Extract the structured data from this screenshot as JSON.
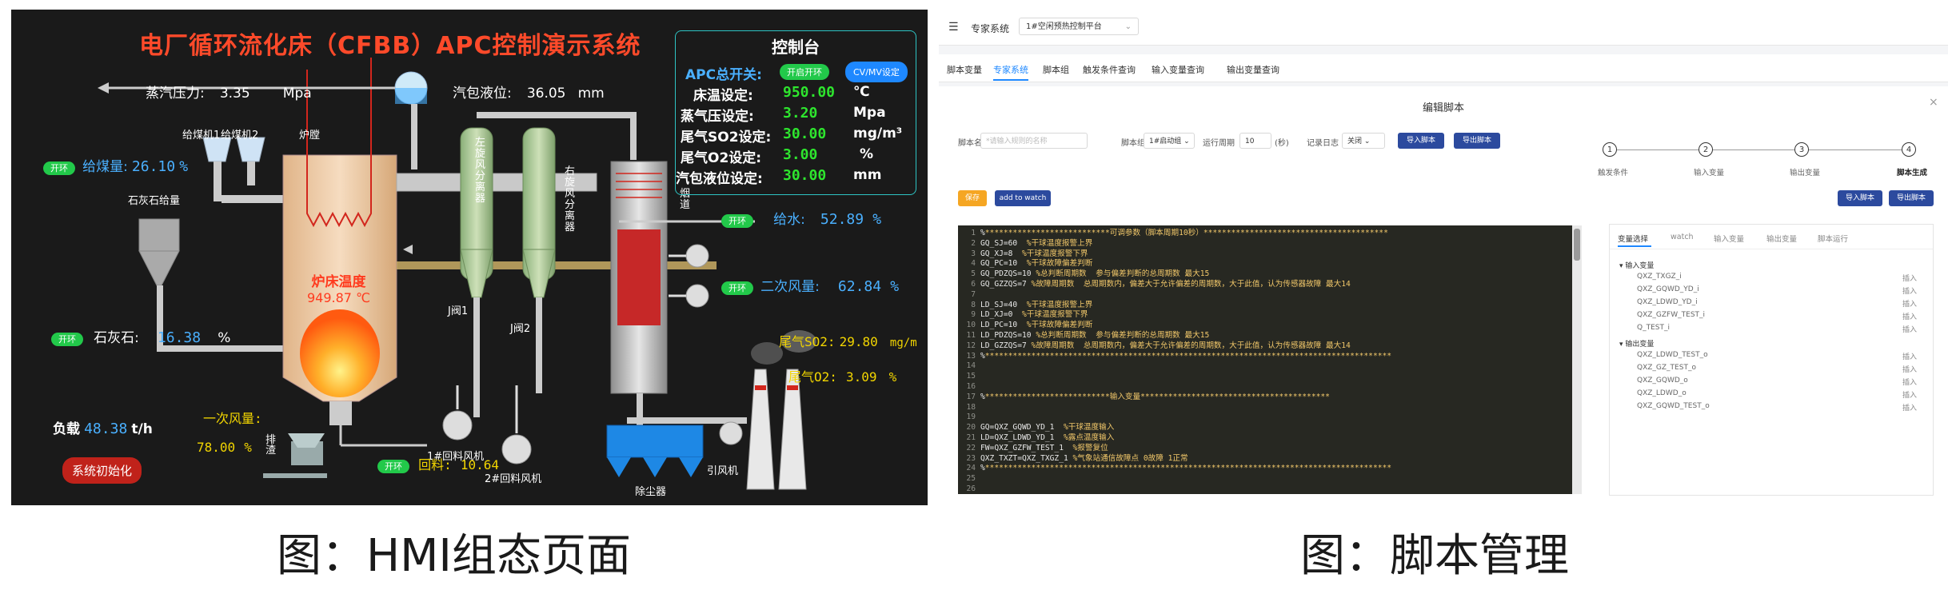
{
  "hmi": {
    "title": "电厂循环流化床（CFBB）APC控制演示系统",
    "steam_pressure": {
      "label": "蒸汽压力:",
      "value": "3.35",
      "unit": "Mpa"
    },
    "drum_level": {
      "label": "汽包液位:",
      "value": "36.05",
      "unit": "mm"
    },
    "coal_feeder1": "给煤机1",
    "coal_feeder2": "给煤机2",
    "furnace_label": "炉膛",
    "left_separator": "左旋风分离器",
    "right_separator": "右旋风分离器",
    "flue_label": "烟道",
    "limestone_bin": "石灰石给量",
    "coal_feed": {
      "toggle": "开环",
      "label": "给煤量:",
      "value": "26.10",
      "unit": "%"
    },
    "bed_temp": {
      "label": "炉床温度",
      "value": "949.87",
      "unit": "℃"
    },
    "valve1": "J阀1",
    "valve2": "J阀2",
    "feed_water": {
      "toggle": "开环",
      "label": "给水:",
      "value": "52.89",
      "unit": "%"
    },
    "secondary_air": {
      "toggle": "开环",
      "label": "二次风量:",
      "value": "62.84",
      "unit": "%"
    },
    "limestone": {
      "toggle": "开环",
      "label": "石灰石:",
      "value": "16.38",
      "unit": "%"
    },
    "flue_so2": {
      "label": "尾气SO2:",
      "value": "29.80",
      "unit": "mg/m"
    },
    "flue_o2": {
      "label": "尾气O2:",
      "value": "3.09",
      "unit": "%"
    },
    "primary_air": {
      "label": "一次风量:",
      "value": "78.00",
      "unit": "%"
    },
    "load": {
      "label": "负载",
      "value": "48.38",
      "unit": "t/h"
    },
    "discharge": "排渣",
    "return_fan1": "1#回料风机",
    "return_fan2": "2#回料风机",
    "return_feed": {
      "toggle": "开环",
      "label": "回料:",
      "value": "10.64"
    },
    "dust_collector": "除尘器",
    "induced_fan": "引风机",
    "init_button": "系统初始化",
    "console": {
      "title": "控制台",
      "apc_label": "APC总开关:",
      "apc_toggle": "开启开环",
      "cvmv_button": "CV/MV设定",
      "rows": [
        {
          "label": "床温设定:",
          "value": "950.00",
          "unit": "℃"
        },
        {
          "label": "蒸气压设定:",
          "value": "3.20",
          "unit": "Mpa"
        },
        {
          "label": "尾气SO2设定:",
          "value": "30.00",
          "unit": "mg/m³"
        },
        {
          "label": "尾气O2设定:",
          "value": "3.00",
          "unit": "%"
        },
        {
          "label": "汽包液位设定:",
          "value": "30.00",
          "unit": "mm"
        }
      ]
    }
  },
  "script_mgr": {
    "menu_icon": "menu-icon",
    "system_name": "专家系统",
    "platform": "1#空闲预热控制平台",
    "tabs": [
      "脚本变量",
      "专家系统",
      "脚本组",
      "触发条件查询",
      "输入变量查询",
      "输出变量查询"
    ],
    "active_tab": 1,
    "edit_title": "编辑脚本",
    "form": {
      "script_name_label": "脚本名",
      "script_name_placeholder": "*请输入规则的名称",
      "group_label": "脚本组",
      "group_value": "1#启动组",
      "period_label": "运行周期",
      "period_value": "10",
      "period_unit": "(秒)",
      "log_label": "记录日志",
      "log_value": "关闭",
      "import_btn": "导入脚本",
      "export_btn": "导出脚本"
    },
    "steps": [
      {
        "n": "1",
        "label": "触发条件"
      },
      {
        "n": "2",
        "label": "输入变量"
      },
      {
        "n": "3",
        "label": "输出变量"
      },
      {
        "n": "4",
        "label": "脚本生成"
      }
    ],
    "save_btn": "保存",
    "watch_btn": "add to watch",
    "import_btn2": "导入脚本",
    "export_btn2": "导出脚本",
    "code_lines": [
      {
        "n": "1",
        "a": "%",
        "b": "***************************可调参数（脚本周期10秒）****************************************"
      },
      {
        "n": "2",
        "a": "GQ_SJ=60  ",
        "b": "%干球温度报警上界"
      },
      {
        "n": "3",
        "a": "GQ_XJ=8  ",
        "b": "%干球温度报警下界"
      },
      {
        "n": "4",
        "a": "GQ_PC=10  ",
        "b": "%干球故障偏差判断"
      },
      {
        "n": "5",
        "a": "GQ_PDZQS=10 ",
        "b": "%总判断周期数  参与偏差判断的总周期数 最大15"
      },
      {
        "n": "6",
        "a": "GQ_GZZQS=7 ",
        "b": "%故障周期数  总周期数内，偏差大于允许偏差的周期数，大于此值，认为传感器故障 最大14"
      },
      {
        "n": "7",
        "a": "",
        "b": ""
      },
      {
        "n": "8",
        "a": "LD_SJ=40  ",
        "b": "%干球温度报警上界"
      },
      {
        "n": "9",
        "a": "LD_XJ=0  ",
        "b": "%干球温度报警下界"
      },
      {
        "n": "10",
        "a": "LD_PC=10  ",
        "b": "%干球故障偏差判断"
      },
      {
        "n": "11",
        "a": "LD_PDZQS=10 ",
        "b": "%总判断周期数  参与偏差判断的总周期数 最大15"
      },
      {
        "n": "12",
        "a": "LD_GZZQS=7 ",
        "b": "%故障周期数  总周期数内，偏差大于允许偏差的周期数，大于此值，认为传感器故障 最大14"
      },
      {
        "n": "13",
        "a": "%",
        "b": "****************************************************************************************"
      },
      {
        "n": "14",
        "a": "",
        "b": ""
      },
      {
        "n": "15",
        "a": "",
        "b": ""
      },
      {
        "n": "16",
        "a": "",
        "b": ""
      },
      {
        "n": "17",
        "a": "%",
        "b": "***************************输入变量*****************************************"
      },
      {
        "n": "18",
        "a": "",
        "b": ""
      },
      {
        "n": "19",
        "a": "",
        "b": ""
      },
      {
        "n": "20",
        "a": "GQ=QXZ_GQWD_YD_1  ",
        "b": "%干球温度输入"
      },
      {
        "n": "21",
        "a": "LD=QXZ_LDWD_YD_1  ",
        "b": "%露点温度输入"
      },
      {
        "n": "22",
        "a": "FW=QXZ_GZFW_TEST_1  ",
        "b": "%报警复位"
      },
      {
        "n": "23",
        "a": "QXZ_TXZT=QXZ_TXGZ_1 ",
        "b": "%气象站通信故障点 0故障 1正常"
      },
      {
        "n": "24",
        "a": "%",
        "b": "****************************************************************************************"
      },
      {
        "n": "25",
        "a": "",
        "b": ""
      },
      {
        "n": "26",
        "a": "",
        "b": ""
      }
    ],
    "side_tabs": [
      "变量选择",
      "watch",
      "输入变量",
      "输出变量",
      "脚本运行"
    ],
    "tree": {
      "input_group": "输入变量",
      "inputs": [
        "QXZ_TXGZ_i",
        "QXZ_GQWD_YD_i",
        "QXZ_LDWD_YD_i",
        "QXZ_GZFW_TEST_i",
        "Q_TEST_i"
      ],
      "output_group": "输出变量",
      "outputs": [
        "QXZ_LDWD_TEST_o",
        "QXZ_GZ_TEST_o",
        "QXZ_GQWD_o",
        "QXZ_LDWD_o",
        "QXZ_GQWD_TEST_o"
      ],
      "action": "插入"
    }
  },
  "captions": {
    "left": "图：HMI组态页面",
    "right": "图：脚本管理"
  }
}
